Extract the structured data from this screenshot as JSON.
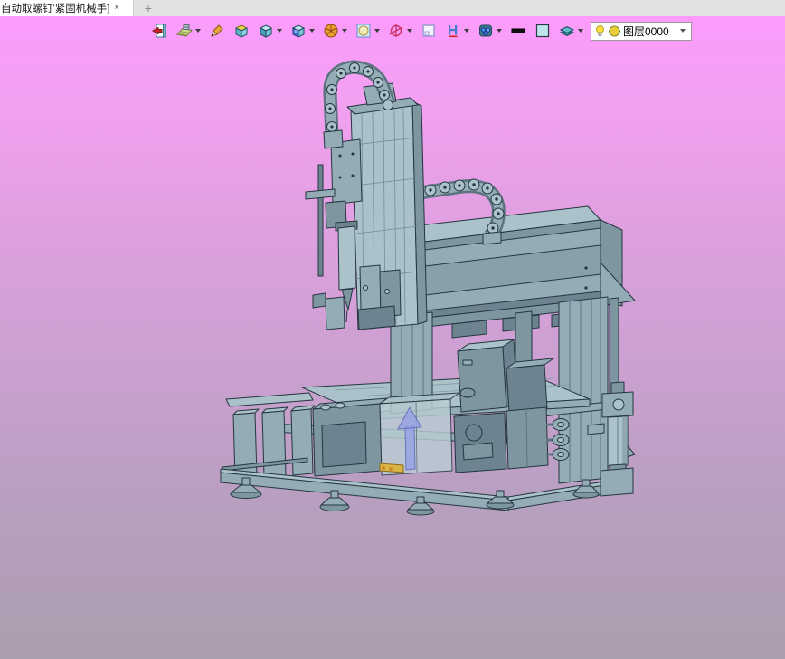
{
  "tab_bar": {
    "active_tab": {
      "title": "自动取螺钉'紧固机械手]",
      "close_label": "×"
    },
    "new_tab_label": "+"
  },
  "toolbar": {
    "icons": [
      {
        "name": "exit-sketch-icon",
        "dropdown": false
      },
      {
        "name": "sketch-plane-icon",
        "dropdown": true
      },
      {
        "name": "pencil-icon",
        "dropdown": false
      },
      {
        "name": "extrude-box-icon",
        "dropdown": false
      },
      {
        "name": "solid-cube-icon",
        "dropdown": true
      },
      {
        "name": "feature-cube-icon",
        "dropdown": true
      },
      {
        "name": "revolve-wheel-icon",
        "dropdown": true
      },
      {
        "name": "sphere-in-box-icon",
        "dropdown": true
      },
      {
        "name": "datum-axis-icon",
        "dropdown": true
      },
      {
        "name": "local-frame-icon",
        "dropdown": false
      },
      {
        "name": "dimension-h-icon",
        "dropdown": true
      },
      {
        "name": "assembly-icon",
        "dropdown": true
      },
      {
        "name": "line-style-icon",
        "dropdown": false
      },
      {
        "name": "fill-color-icon",
        "dropdown": false
      },
      {
        "name": "layers-icon",
        "dropdown": true
      }
    ],
    "layer_selector": {
      "value": "图层0000"
    }
  },
  "viewport": {
    "background_top": "#fc9bfc",
    "background_bottom": "#ab9eae",
    "model_fill_light": "#abc2ca",
    "model_fill_dark": "#7e96a0",
    "model_outline": "#253640",
    "arrow_color": "#97a1e4",
    "highlight_yellow": "#d9b545",
    "model_parts": [
      "base-frame",
      "leveling-feet",
      "work-table",
      "gantry-beam",
      "right-columns",
      "z-axis-tower",
      "cable-chain-top",
      "cable-chain-beam",
      "control-box",
      "pneumatic-frl-unit",
      "direction-arrow"
    ]
  }
}
